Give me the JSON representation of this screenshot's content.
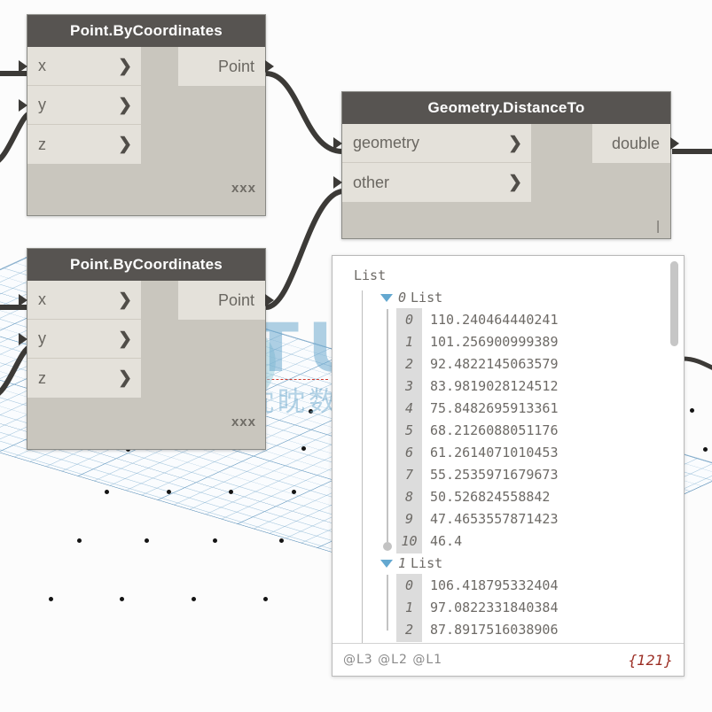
{
  "app": {
    "name": "dynamo-graph-editor"
  },
  "nodes": [
    {
      "title": "Point.ByCoordinates",
      "inputs": [
        "x",
        "y",
        "z"
      ],
      "outputs": [
        "Point"
      ],
      "footer": "xxx"
    },
    {
      "title": "Geometry.DistanceTo",
      "inputs": [
        "geometry",
        "other"
      ],
      "outputs": [
        "double"
      ],
      "footer": "|"
    },
    {
      "title": "Point.ByCoordinates",
      "inputs": [
        "x",
        "y",
        "z"
      ],
      "outputs": [
        "Point"
      ],
      "footer": "xxx"
    }
  ],
  "list_panel": {
    "root_label": "List",
    "groups": [
      {
        "index": "0",
        "type_label": "List",
        "expanded": true,
        "items": [
          {
            "key": "0",
            "value": "110.240464440241"
          },
          {
            "key": "1",
            "value": "101.256900999389"
          },
          {
            "key": "2",
            "value": "92.4822145063579"
          },
          {
            "key": "3",
            "value": "83.9819028124512"
          },
          {
            "key": "4",
            "value": "75.8482695913361"
          },
          {
            "key": "5",
            "value": "68.2126088051176"
          },
          {
            "key": "6",
            "value": "61.2614071010453"
          },
          {
            "key": "7",
            "value": "55.2535971679673"
          },
          {
            "key": "8",
            "value": "50.526824558842"
          },
          {
            "key": "9",
            "value": "47.4653557871423"
          },
          {
            "key": "10",
            "value": "46.4"
          }
        ]
      },
      {
        "index": "1",
        "type_label": "List",
        "expanded": true,
        "items": [
          {
            "key": "0",
            "value": "106.418795332404"
          },
          {
            "key": "1",
            "value": "97.0822331840384"
          },
          {
            "key": "2",
            "value": "87.8917516038906"
          }
        ]
      }
    ],
    "footer": {
      "levels": "@L3 @L2 @L1",
      "count": "{121}"
    }
  },
  "watermark": {
    "text": "UITUISOFT",
    "subtext": "眈眈数字网"
  },
  "colors": {
    "node_header": "#575451",
    "node_body": "#c9c6be",
    "port": "#e4e1da",
    "wire": "#3c3a37",
    "grid": "#6ba3c8",
    "accent_blue": "#64a8d0",
    "count_red": "#9b2d23"
  }
}
